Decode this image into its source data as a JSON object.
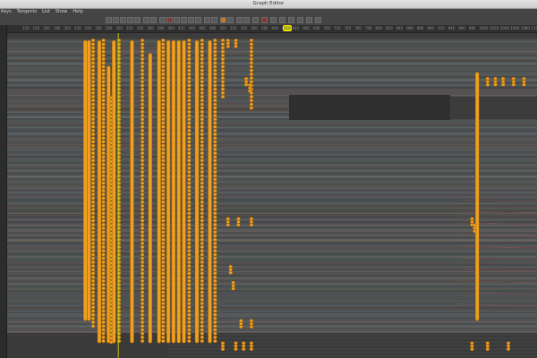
{
  "window": {
    "title": "Graph Editor"
  },
  "menu": [
    "Keys",
    "Tangents",
    "List",
    "Show",
    "Help"
  ],
  "toolbar": {
    "icons": [
      "move-key-icon",
      "insert-key-icon",
      "lattice-icon",
      "region-icon",
      "frame-all-icon",
      "frame-playback-icon",
      "center-current-icon",
      "spline-tangent-icon",
      "clamped-tangent-icon",
      "linear-tangent-icon",
      "flat-tangent-icon",
      "step-tangent-icon",
      "plateau-tangent-icon",
      "break-tangent-icon",
      "unify-tangent-icon",
      "free-weight-icon",
      "lock-weight-icon",
      "buffer-curve-icon",
      "swap-buffer-icon",
      "snap-icon",
      "normalize-icon",
      "denormalize-icon",
      "infinity-icon",
      "pre-infinity-icon",
      "post-infinity-icon",
      "dope-sheet-icon",
      "trax-icon"
    ],
    "accent_active": "#c8781a",
    "accent_red": "#8a3434"
  },
  "timeline": {
    "ticks": [
      "120",
      "140",
      "160",
      "180",
      "200",
      "220",
      "240",
      "260",
      "280",
      "300",
      "320",
      "340",
      "360",
      "380",
      "400",
      "420",
      "440",
      "460",
      "480",
      "500",
      "520",
      "540",
      "560",
      "580",
      "600",
      "620",
      "640",
      "660",
      "680",
      "700",
      "720",
      "740",
      "760",
      "780",
      "800",
      "820",
      "840",
      "860",
      "880",
      "900",
      "920",
      "940",
      "960",
      "980",
      "1000",
      "1020",
      "1040",
      "1060",
      "1080",
      "1100",
      "1120"
    ],
    "current_frame": "310"
  },
  "colors": {
    "key": "#f0a020",
    "key_outline": "#9a6008",
    "current_time": "#c8c800",
    "background": "#3c3c3c",
    "curve_dark": "#222222"
  },
  "key_columns": [
    {
      "frame": 255,
      "from": 0.02,
      "to": 0.9,
      "style": "solid"
    },
    {
      "frame": 262,
      "from": 0.02,
      "to": 0.9,
      "style": "solid"
    },
    {
      "frame": 270,
      "from": 0.02,
      "to": 0.92,
      "style": "bead"
    },
    {
      "frame": 282,
      "from": 0.02,
      "to": 0.97,
      "style": "solid"
    },
    {
      "frame": 290,
      "from": 0.02,
      "to": 0.97,
      "style": "bead"
    },
    {
      "frame": 300,
      "from": 0.1,
      "to": 0.97,
      "style": "solid"
    },
    {
      "frame": 305,
      "from": 0.2,
      "to": 0.97,
      "style": "bead"
    },
    {
      "frame": 310,
      "from": 0.02,
      "to": 0.97,
      "style": "solid"
    },
    {
      "frame": 320,
      "from": 0.02,
      "to": 0.97,
      "style": "bead"
    },
    {
      "frame": 345,
      "from": 0.02,
      "to": 0.97,
      "style": "solid"
    },
    {
      "frame": 365,
      "from": 0.02,
      "to": 0.97,
      "style": "bead"
    },
    {
      "frame": 380,
      "from": 0.06,
      "to": 0.97,
      "style": "solid"
    },
    {
      "frame": 397,
      "from": 0.02,
      "to": 0.97,
      "style": "solid"
    },
    {
      "frame": 405,
      "from": 0.02,
      "to": 0.97,
      "style": "bead"
    },
    {
      "frame": 415,
      "from": 0.02,
      "to": 0.97,
      "style": "solid"
    },
    {
      "frame": 425,
      "from": 0.02,
      "to": 0.97,
      "style": "solid"
    },
    {
      "frame": 435,
      "from": 0.02,
      "to": 0.97,
      "style": "solid"
    },
    {
      "frame": 445,
      "from": 0.02,
      "to": 0.97,
      "style": "solid"
    },
    {
      "frame": 455,
      "from": 0.02,
      "to": 0.97,
      "style": "bead"
    },
    {
      "frame": 470,
      "from": 0.02,
      "to": 0.97,
      "style": "solid"
    },
    {
      "frame": 480,
      "from": 0.02,
      "to": 0.97,
      "style": "bead"
    },
    {
      "frame": 495,
      "from": 0.02,
      "to": 0.97,
      "style": "solid"
    },
    {
      "frame": 505,
      "from": 0.02,
      "to": 0.97,
      "style": "bead"
    },
    {
      "frame": 520,
      "from": 0.02,
      "to": 0.2,
      "style": "bead"
    },
    {
      "frame": 575,
      "from": 0.02,
      "to": 0.24,
      "style": "bead"
    },
    {
      "frame": 1010,
      "from": 0.12,
      "to": 0.9,
      "style": "solid"
    }
  ],
  "key_clusters": [
    {
      "frame": 530,
      "row": 0.02
    },
    {
      "frame": 545,
      "row": 0.02
    },
    {
      "frame": 565,
      "row": 0.14
    },
    {
      "frame": 572,
      "row": 0.16
    },
    {
      "frame": 530,
      "row": 0.58
    },
    {
      "frame": 550,
      "row": 0.58
    },
    {
      "frame": 575,
      "row": 0.58
    },
    {
      "frame": 535,
      "row": 0.73
    },
    {
      "frame": 540,
      "row": 0.78
    },
    {
      "frame": 555,
      "row": 0.9
    },
    {
      "frame": 575,
      "row": 0.9
    },
    {
      "frame": 520,
      "row": 0.97
    },
    {
      "frame": 545,
      "row": 0.97
    },
    {
      "frame": 560,
      "row": 0.97
    },
    {
      "frame": 575,
      "row": 0.97
    },
    {
      "frame": 1030,
      "row": 0.14
    },
    {
      "frame": 1045,
      "row": 0.14
    },
    {
      "frame": 1060,
      "row": 0.14
    },
    {
      "frame": 1080,
      "row": 0.14
    },
    {
      "frame": 1100,
      "row": 0.14
    },
    {
      "frame": 1000,
      "row": 0.58
    },
    {
      "frame": 1005,
      "row": 0.6
    },
    {
      "frame": 1000,
      "row": 0.97
    },
    {
      "frame": 1030,
      "row": 0.97
    },
    {
      "frame": 1070,
      "row": 0.97
    }
  ]
}
